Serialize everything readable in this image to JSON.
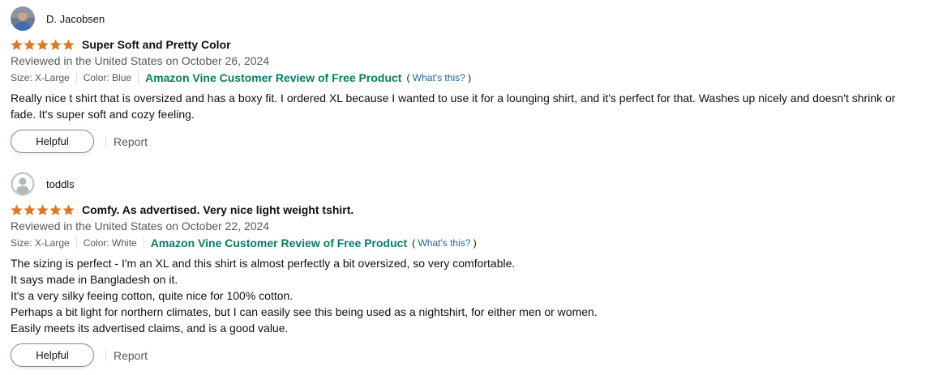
{
  "reviews": [
    {
      "reviewer": "D. Jacobsen",
      "avatar_icon": "profile-photo",
      "rating": 5,
      "title": "Super Soft and Pretty Color",
      "date_line": "Reviewed in the United States on October 26, 2024",
      "size": "Size: X-Large",
      "color": "Color: Blue",
      "vine_label": "Amazon Vine Customer Review of Free Product",
      "whats_this_open": "(",
      "whats_this": "What's this?",
      "whats_this_close": ")",
      "body_lines": [
        "Really nice t shirt that is oversized and has a boxy fit. I ordered XL because I wanted to use it for a lounging shirt, and it's perfect for that. Washes up nicely and doesn't shrink or fade. It's super soft and cozy feeling."
      ],
      "helpful_label": "Helpful",
      "report_label": "Report"
    },
    {
      "reviewer": "toddls",
      "avatar_icon": "default-avatar",
      "rating": 5,
      "title": "Comfy. As advertised. Very nice light weight tshirt.",
      "date_line": "Reviewed in the United States on October 22, 2024",
      "size": "Size: X-Large",
      "color": "Color: White",
      "vine_label": "Amazon Vine Customer Review of Free Product",
      "whats_this_open": "(",
      "whats_this": "What's this?",
      "whats_this_close": ")",
      "body_lines": [
        "The sizing is perfect - I'm an XL and this shirt is almost perfectly a bit oversized, so very comfortable.",
        "It says made in Bangladesh on it.",
        "It's a very silky feeing cotton, quite nice for 100% cotton.",
        "Perhaps a bit light for northern climates, but I can easily see this being used as a nightshirt, for either men or women.",
        "Easily meets its advertised claims, and is a good value."
      ],
      "helpful_label": "Helpful",
      "report_label": "Report"
    }
  ],
  "colors": {
    "star": "#de7921",
    "vine_green": "#067d62",
    "link_blue": "#2162a1",
    "secondary_text": "#565959"
  }
}
